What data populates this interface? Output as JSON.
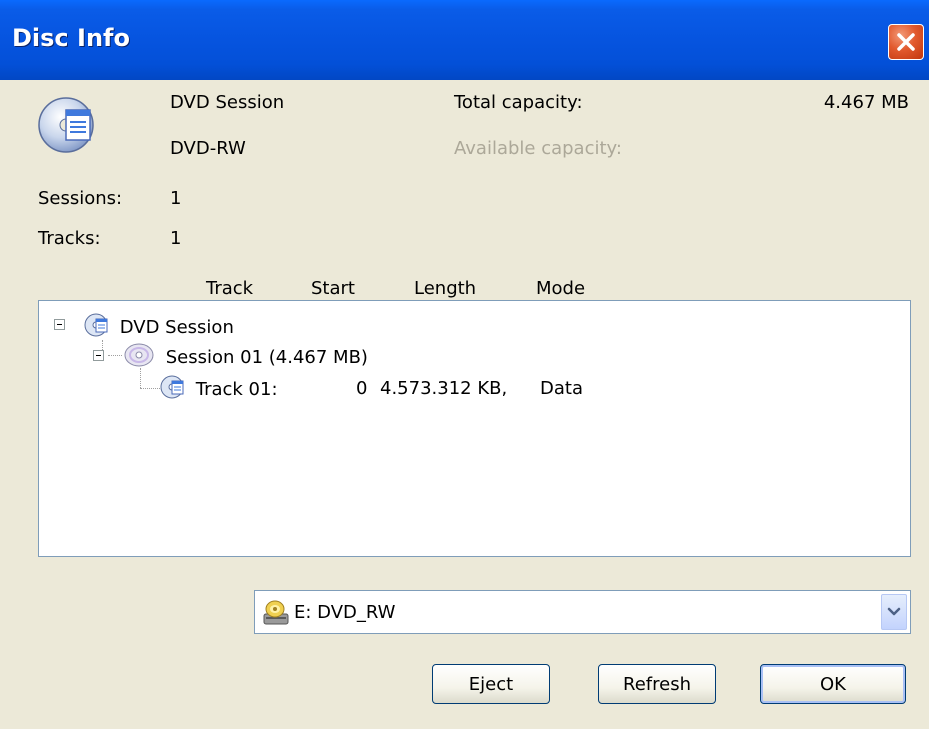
{
  "window": {
    "title": "Disc Info"
  },
  "disc": {
    "type": "DVD Session",
    "media": "DVD-RW",
    "total_capacity_label": "Total capacity:",
    "total_capacity_value": "4.467 MB",
    "available_capacity_label": "Available capacity:",
    "sessions_label": "Sessions:",
    "sessions_value": "1",
    "tracks_label": "Tracks:",
    "tracks_value": "1"
  },
  "tree": {
    "columns": [
      "Track",
      "Start",
      "Length",
      "Mode"
    ],
    "root_label": "DVD Session",
    "session_label": "Session 01 (4.467 MB)",
    "track": {
      "label": "Track 01:",
      "start": "0",
      "length": "4.573.312 KB,",
      "mode": "Data"
    }
  },
  "drive": {
    "selected": "E: DVD_RW"
  },
  "buttons": {
    "eject": "Eject",
    "refresh": "Refresh",
    "ok": "OK"
  },
  "colors": {
    "titlebar": "#0654df",
    "window_bg": "#ece9d8",
    "close_button": "#e25a2e",
    "disabled_text": "#aca899"
  }
}
